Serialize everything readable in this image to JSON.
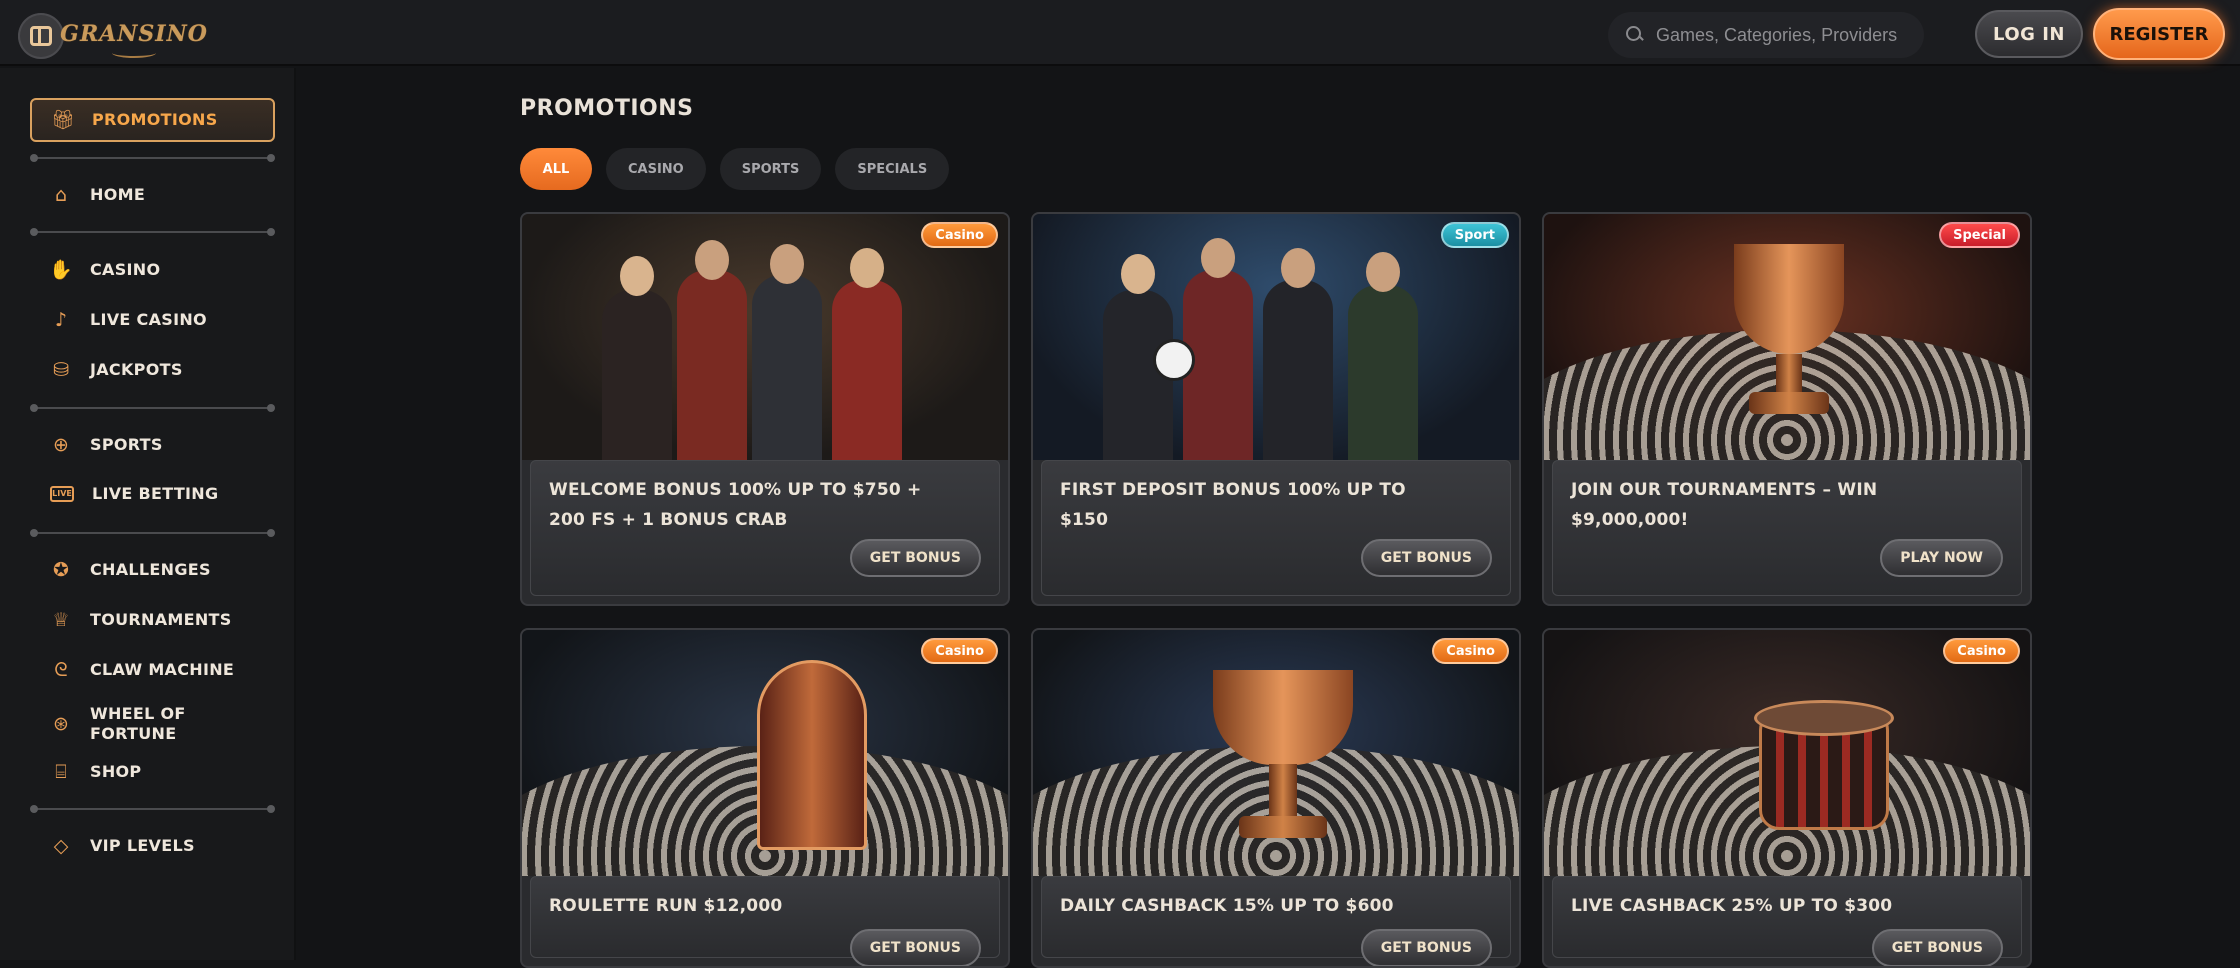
{
  "header": {
    "logo_text": "GRANSINO",
    "search_placeholder": "Games, Categories, Providers",
    "login_label": "LOG IN",
    "register_label": "REGISTER"
  },
  "sidebar": {
    "active": {
      "label": "PROMOTIONS",
      "icon": "gift-icon"
    },
    "items": [
      {
        "label": "HOME",
        "icon": "home-icon"
      },
      {
        "label": "CASINO",
        "icon": "rock-hand-icon"
      },
      {
        "label": "LIVE CASINO",
        "icon": "microphone-icon"
      },
      {
        "label": "JACKPOTS",
        "icon": "jackpot-icon"
      },
      {
        "label": "SPORTS",
        "icon": "basketball-icon"
      },
      {
        "label": "LIVE BETTING",
        "icon": "live-badge-icon"
      },
      {
        "label": "CHALLENGES",
        "icon": "medal-icon"
      },
      {
        "label": "TOURNAMENTS",
        "icon": "trophy-icon"
      },
      {
        "label": "CLAW MACHINE",
        "icon": "claw-icon"
      },
      {
        "label": "WHEEL OF FORTUNE",
        "icon": "wheel-icon"
      },
      {
        "label": "SHOP",
        "icon": "shop-icon"
      },
      {
        "label": "VIP LEVELS",
        "icon": "diamond-icon"
      }
    ],
    "live_badge_text": "LIVE"
  },
  "main": {
    "title": "PROMOTIONS",
    "filters": [
      "ALL",
      "CASINO",
      "SPORTS",
      "SPECIALS"
    ],
    "active_filter": "ALL",
    "cards": [
      {
        "badge": "Casino",
        "badge_type": "casino",
        "title": "WELCOME BONUS 100% UP TO $750 + 200 FS + 1 BONUS CRAB",
        "button": "GET BONUS"
      },
      {
        "badge": "Sport",
        "badge_type": "sport",
        "title": "FIRST DEPOSIT BONUS 100% UP TO $150",
        "button": "GET BONUS"
      },
      {
        "badge": "Special",
        "badge_type": "special",
        "title": "JOIN OUR TOURNAMENTS – WIN $9,000,000!",
        "button": "PLAY NOW"
      },
      {
        "badge": "Casino",
        "badge_type": "casino",
        "title": "ROULETTE RUN $12,000",
        "button": "GET BONUS"
      },
      {
        "badge": "Casino",
        "badge_type": "casino",
        "title": "DAILY CASHBACK 15% UP TO $600",
        "button": "GET BONUS"
      },
      {
        "badge": "Casino",
        "badge_type": "casino",
        "title": "LIVE CASHBACK 25% UP TO $300",
        "button": "GET BONUS"
      }
    ]
  },
  "colors": {
    "accent": "#f7a74b",
    "register": "#e5661c",
    "badge_casino": "#f08a2c",
    "badge_sport": "#2aa9bd",
    "badge_special": "#e02f36",
    "background": "#131416"
  }
}
